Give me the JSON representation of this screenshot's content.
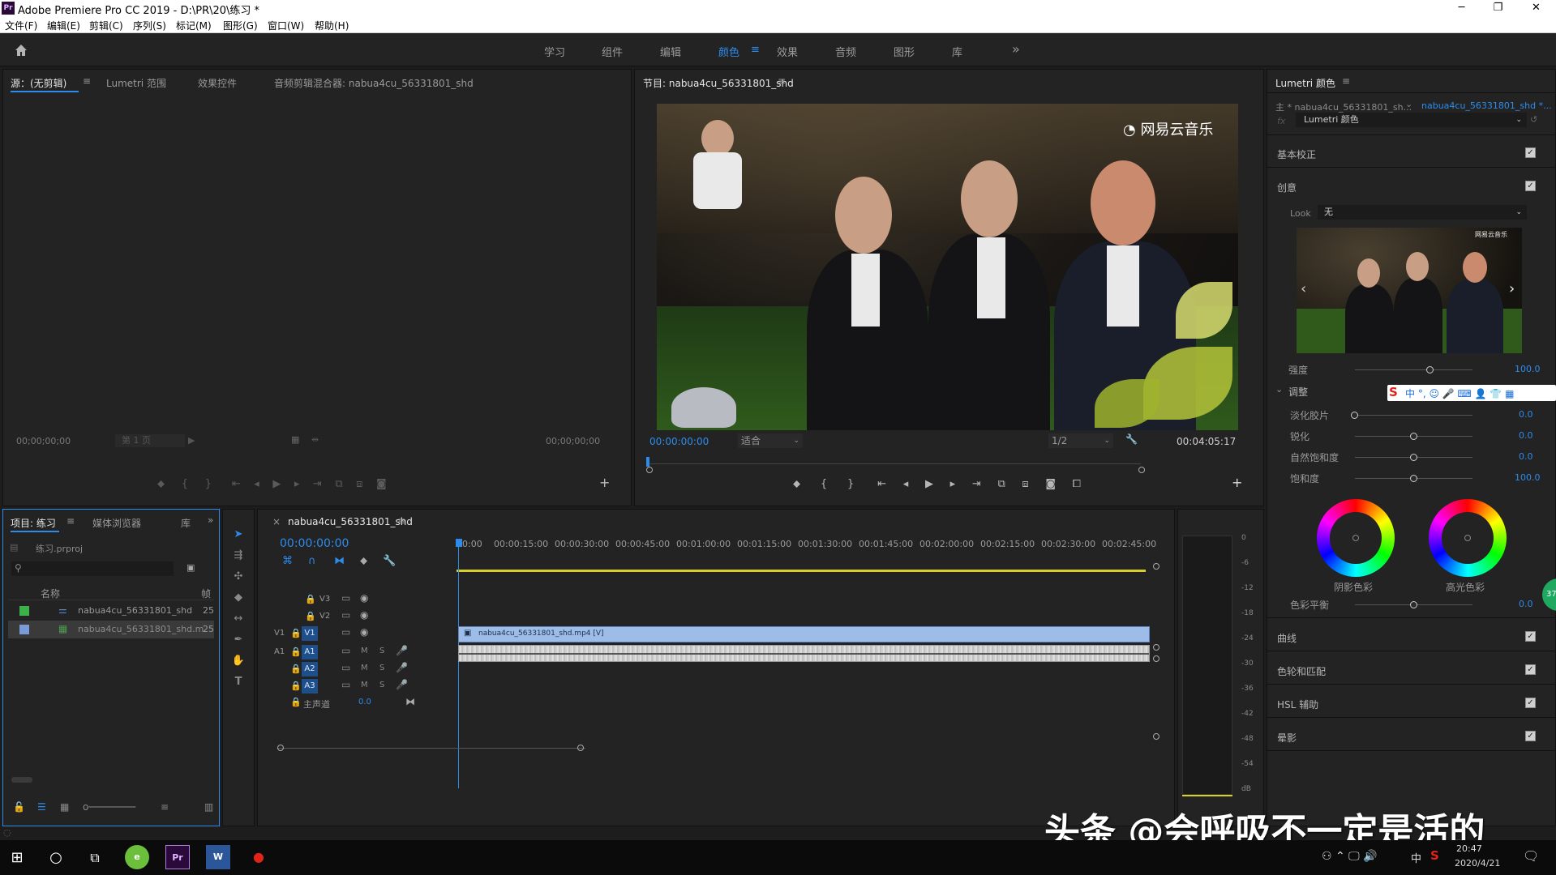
{
  "window": {
    "title": "Adobe Premiere Pro CC 2019 - D:\\PR\\20\\练习 *",
    "minimize": "─",
    "maximize": "❐",
    "close": "✕"
  },
  "menu": [
    "文件(F)",
    "编辑(E)",
    "剪辑(C)",
    "序列(S)",
    "标记(M)",
    "图形(G)",
    "窗口(W)",
    "帮助(H)"
  ],
  "workspaces": {
    "items": [
      "学习",
      "组件",
      "编辑",
      "颜色",
      "效果",
      "音频",
      "图形",
      "库"
    ],
    "active": "颜色",
    "more": "»"
  },
  "source_panel": {
    "tabs": [
      "源：(无剪辑)",
      "Lumetri 范围",
      "效果控件",
      "音频剪辑混合器: nabua4cu_56331801_shd"
    ],
    "tc_left": "00;00;00;00",
    "page_select": "第 1 页",
    "tc_right": "00;00;00;00"
  },
  "program_panel": {
    "tab": "节目: nabua4cu_56331801_shd",
    "video_watermark": "网易云音乐",
    "timecode": "00:00:00:00",
    "fit": "适合",
    "resolution": "1/2",
    "duration": "00:04:05:17"
  },
  "lumetri_panel": {
    "tab": "Lumetri 颜色",
    "master_clip": "主 * nabua4cu_56331801_sh...",
    "sequence_clip": "nabua4cu_56331801_shd *...",
    "effect_name": "Lumetri 颜色",
    "fx_label": "fx",
    "sections_top": [
      {
        "name": "基本校正",
        "checked": true
      },
      {
        "name": "创意",
        "checked": true
      }
    ],
    "look_label": "Look",
    "look_value": "无",
    "preview_watermark": "网易云音乐",
    "intensity_label": "强度",
    "intensity_value": "100.0",
    "adjust_label": "调整",
    "ime_toolbar": "中 °, ☺ 🎤 ⌨ 👤 👕 ▦",
    "sliders": [
      {
        "label": "淡化胶片",
        "value": "0.0",
        "pos": 0.0
      },
      {
        "label": "锐化",
        "value": "0.0",
        "pos": 0.5
      },
      {
        "label": "自然饱和度",
        "value": "0.0",
        "pos": 0.5
      },
      {
        "label": "饱和度",
        "value": "100.0",
        "pos": 0.5
      }
    ],
    "shadow_tint": "阴影色彩",
    "highlight_tint": "高光色彩",
    "color_balance_label": "色彩平衡",
    "color_balance_value": "0.0",
    "sections_bottom": [
      {
        "name": "曲线",
        "checked": true
      },
      {
        "name": "色轮和匹配",
        "checked": true
      },
      {
        "name": "HSL 辅助",
        "checked": true
      },
      {
        "name": "晕影",
        "checked": true
      }
    ],
    "badge": "37"
  },
  "project_panel": {
    "tabs": [
      "项目: 练习",
      "媒体浏览器",
      "库"
    ],
    "project_file": "练习.prproj",
    "column_name": "名称",
    "column_rate": "帧",
    "items": [
      {
        "name": "nabua4cu_56331801_shd",
        "rate": "25",
        "color": "#3cb04b"
      },
      {
        "name": "nabua4cu_56331801_shd.m",
        "rate": "25",
        "color": "#7a9bd6"
      }
    ]
  },
  "timeline_panel": {
    "tab": "nabua4cu_56331801_shd",
    "close": "×",
    "timecode": "00:00:00:00",
    "ruler": [
      "00:00",
      "00:00:15:00",
      "00:00:30:00",
      "00:00:45:00",
      "00:01:00:00",
      "00:01:15:00",
      "00:01:30:00",
      "00:01:45:00",
      "00:02:00:00",
      "00:02:15:00",
      "00:02:30:00",
      "00:02:45:00"
    ],
    "video_tracks": [
      "V3",
      "V2",
      "V1"
    ],
    "audio_tracks": [
      "A1",
      "A2",
      "A3"
    ],
    "src_v": "V1",
    "src_a": "A1",
    "master": "主声道",
    "master_value": "0.0",
    "video_clip": "nabua4cu_56331801_shd.mp4 [V]"
  },
  "meter": {
    "scale": [
      "0",
      "-6",
      "-12",
      "-18",
      "-24",
      "-30",
      "-36",
      "-42",
      "-48",
      "-54",
      "dB"
    ]
  },
  "watermark": "头条 @会呼吸不一定是活的",
  "taskbar": {
    "time": "20:47",
    "date": "2020/4/21",
    "ime": "中",
    "tray_icons": "⚇ ⌃ 🖵 🔊"
  }
}
